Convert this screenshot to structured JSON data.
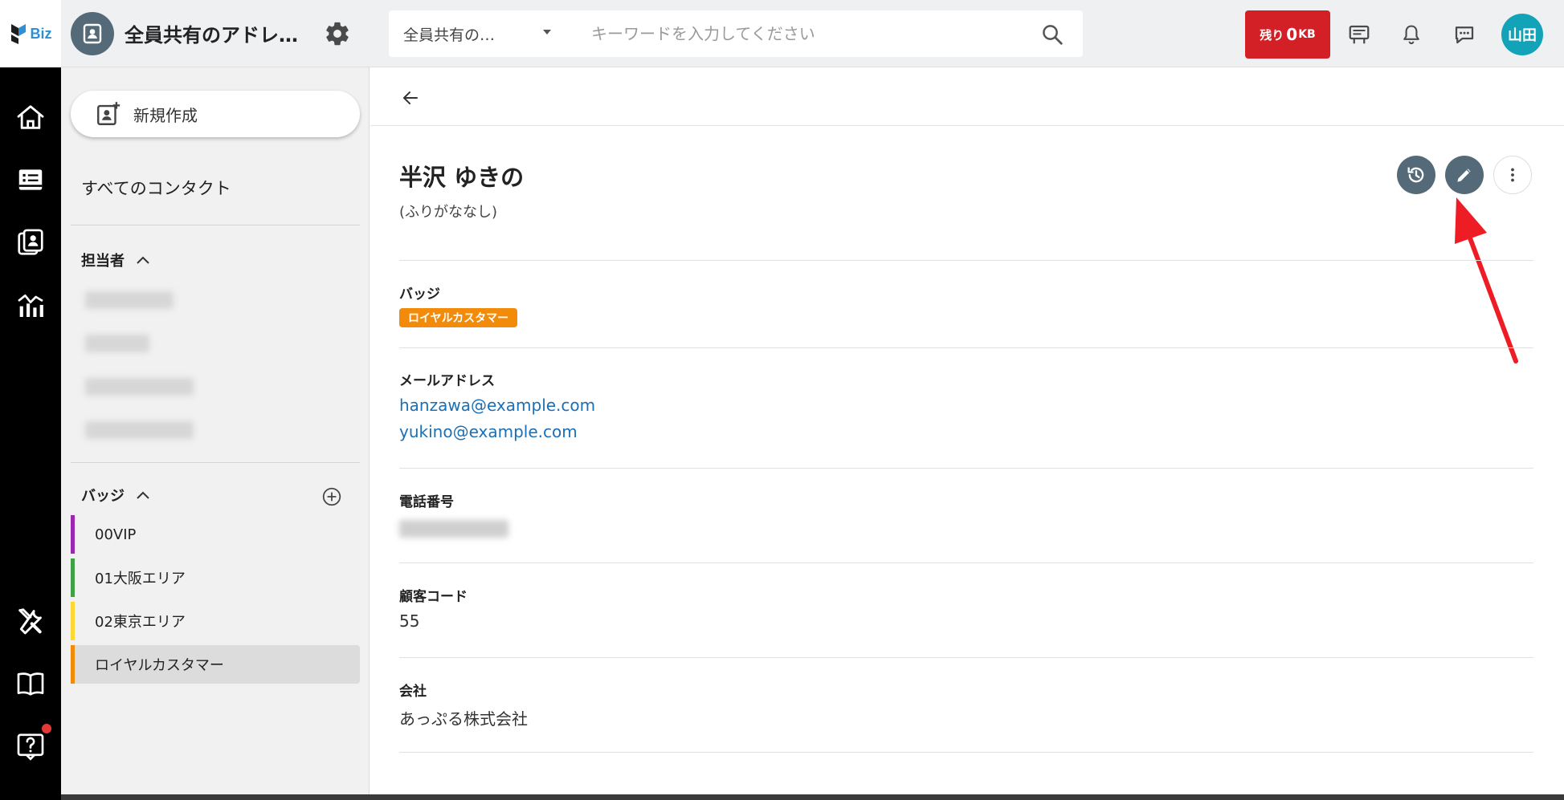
{
  "header": {
    "logo_text": "Biz",
    "folder_title": "全員共有のアドレ…",
    "search": {
      "scope": "全員共有の…",
      "placeholder": "キーワードを入力してください"
    },
    "storage": {
      "label": "残り",
      "value": "0",
      "unit": "KB"
    },
    "avatar_text": "山田",
    "icons": [
      "settings-icon",
      "search-icon",
      "signboard-icon",
      "bell-icon",
      "chat-icon"
    ]
  },
  "rail": {
    "items": [
      "home-icon",
      "list-icon",
      "contacts-icon",
      "chart-icon",
      "tools-icon",
      "book-icon",
      "help-icon"
    ],
    "notification_color": "#e53935"
  },
  "sidebar": {
    "new_label": "新規作成",
    "all_contacts": "すべてのコンタクト",
    "owner_section": "担当者",
    "badge_section": "バッジ",
    "badges": [
      {
        "label": "00VIP",
        "color": "#9c27b0"
      },
      {
        "label": "01大阪エリア",
        "color": "#43a047"
      },
      {
        "label": "02東京エリア",
        "color": "#fdd835"
      },
      {
        "label": "ロイヤルカスタマー",
        "color": "#f28a0a"
      }
    ]
  },
  "contact": {
    "name": "半沢 ゆきの",
    "furigana": "(ふりがななし)",
    "fields": {
      "badge_label": "バッジ",
      "badge_value": "ロイヤルカスタマー",
      "email_label": "メールアドレス",
      "emails": [
        "hanzawa@example.com",
        "yukino@example.com"
      ],
      "phone_label": "電話番号",
      "customer_code_label": "顧客コード",
      "customer_code": "55",
      "company_label": "会社",
      "company": "あっぷる株式会社"
    }
  },
  "colors": {
    "accent": "#546a78",
    "storage_red": "#d32026",
    "badge_orange": "#f28a0a",
    "link_blue": "#1a6fb5",
    "avatar_teal": "#12a3b8"
  }
}
